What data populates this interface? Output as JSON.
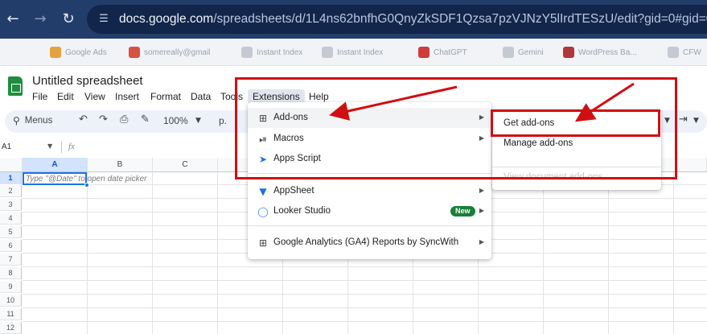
{
  "browser": {
    "url_host": "docs.google.com",
    "url_path": "/spreadsheets/d/1L4ns62bnfhG0QnyZkSDF1Qzsa7pzVJNzY5lIrdTESzU/edit?gid=0#gid=0",
    "icons": [
      "back-arrow-icon",
      "forward-arrow-icon",
      "reload-icon",
      "site-settings-icon"
    ],
    "bookmarks": [
      "Google Ads",
      "somereally@gmail",
      "Instant Index",
      "Instant Index",
      "ChatGPT",
      "Gemini",
      "WordPress Ba...",
      "CFW"
    ]
  },
  "sheets": {
    "title": "Untitled spreadsheet",
    "menu": [
      "File",
      "Edit",
      "View",
      "Insert",
      "Format",
      "Data",
      "Tools",
      "Extensions",
      "Help"
    ],
    "toolbar": {
      "search_label": "Menus",
      "zoom": "100%",
      "format_hint": "p."
    },
    "namebox": "A1",
    "fx_label": "fx",
    "columns": [
      "A",
      "B",
      "C"
    ],
    "rows": [
      "1",
      "2",
      "3",
      "4",
      "5",
      "6",
      "7",
      "8",
      "9",
      "10",
      "11",
      "12"
    ],
    "cell_hint": "Type \"@Date\" to open date picker"
  },
  "extensions_menu": {
    "items": [
      {
        "label": "Add-ons",
        "icon": "add-ons-icon",
        "has_submenu": true
      },
      {
        "label": "Macros",
        "icon": "macros-icon",
        "has_submenu": true
      },
      {
        "label": "Apps Script",
        "icon": "apps-script-icon",
        "has_submenu": false
      },
      {
        "label": "AppSheet",
        "icon": "appsheet-icon",
        "has_submenu": true
      },
      {
        "label": "Looker Studio",
        "icon": "looker-studio-icon",
        "has_submenu": true,
        "badge": "New"
      },
      {
        "label": "Google Analytics (GA4) Reports by SyncWith",
        "icon": "ga4-addon-icon",
        "has_submenu": true
      }
    ]
  },
  "addons_submenu": {
    "items": [
      {
        "label": "Get add-ons"
      },
      {
        "label": "Manage add-ons"
      },
      {
        "label": "View document add-ons"
      }
    ]
  },
  "colors": {
    "annotation_red": "#d00f12",
    "selection_blue": "#1a73e8",
    "sheets_green": "#1e8e3e",
    "badge_green": "#188038"
  }
}
